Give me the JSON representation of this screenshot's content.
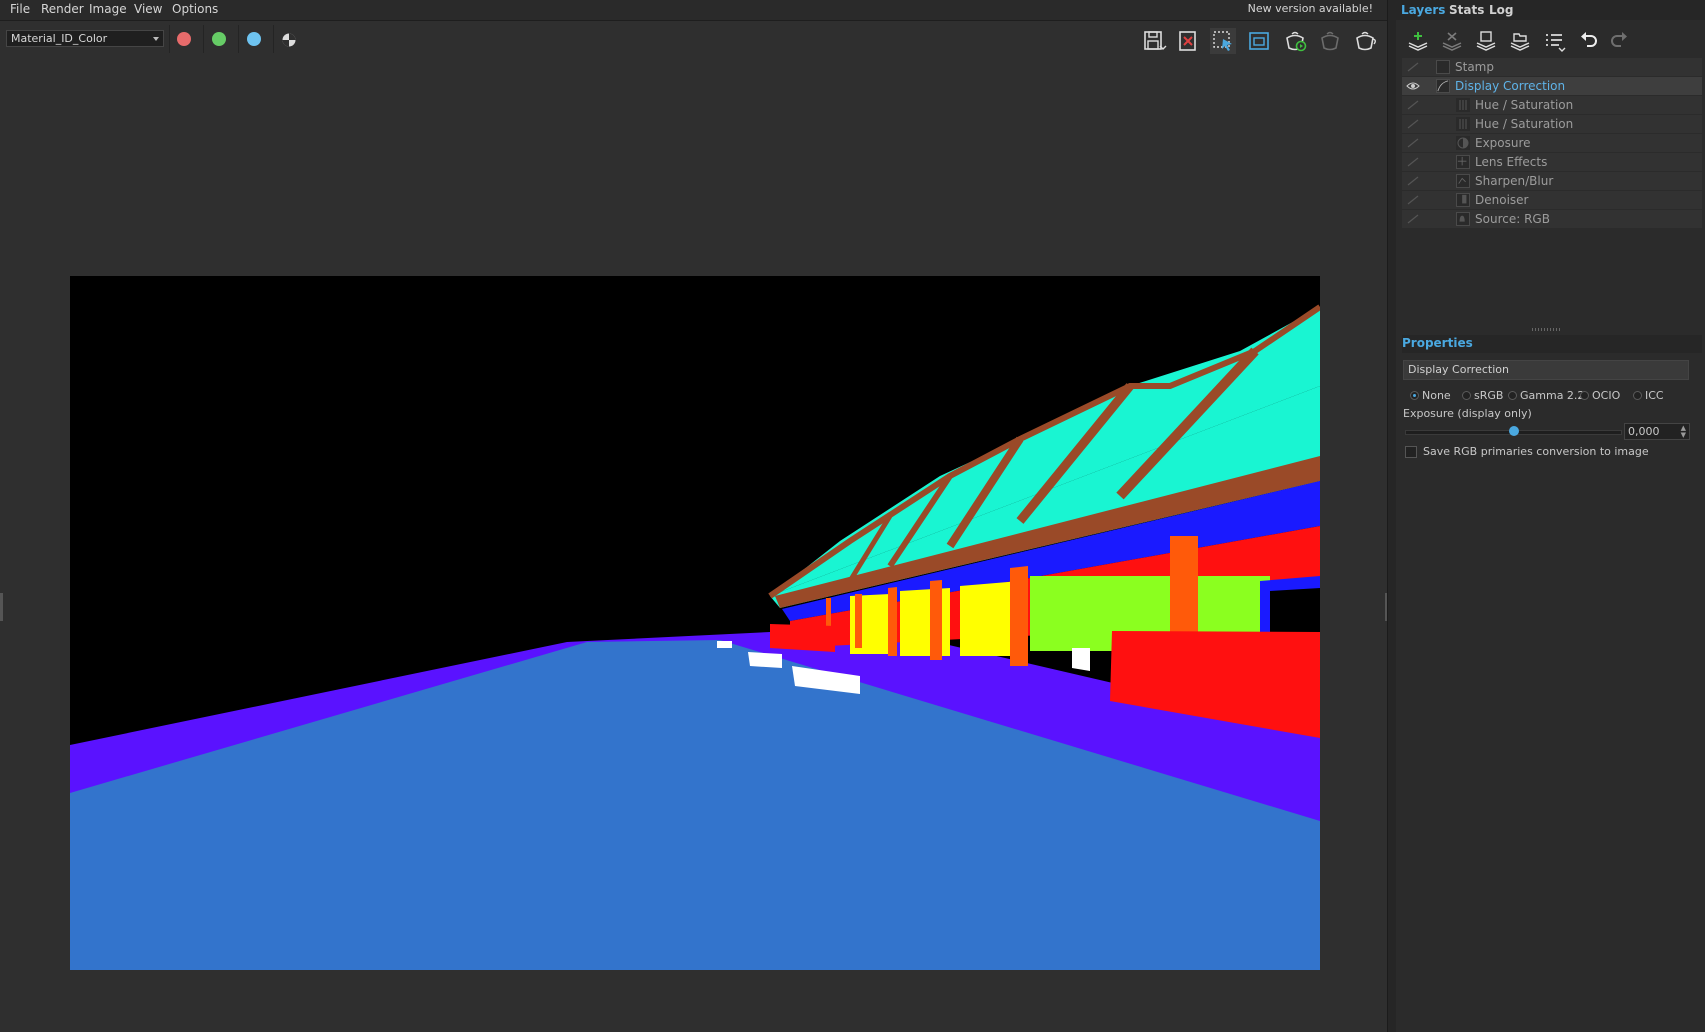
{
  "menu": [
    "File",
    "Render",
    "Image",
    "View",
    "Options"
  ],
  "notice": "New version available!",
  "toolbar": {
    "channel": "Material_ID_Color",
    "channel_dots": [
      {
        "name": "red-channel-toggle",
        "color": "#e76b6b"
      },
      {
        "name": "green-channel-toggle",
        "color": "#66cc66"
      },
      {
        "name": "blue-channel-toggle",
        "color": "#6ec3f0"
      }
    ],
    "icons": [
      "alpha-channel-icon",
      "save-image-icon",
      "clear-image-icon",
      "region-render-icon",
      "frame-buffer-icon",
      "render-icon",
      "stop-render-icon",
      "render-teapot-icon"
    ]
  },
  "tabs": [
    "Layers",
    "Stats",
    "Log"
  ],
  "layer_toolbar_icons": [
    "add-layer-icon",
    "delete-layer-icon",
    "save-layers-icon",
    "load-layers-icon",
    "layer-menu-icon",
    "undo-icon",
    "redo-icon"
  ],
  "layers": [
    {
      "name": "Stamp",
      "indent": 0,
      "selected": false,
      "visible": false
    },
    {
      "name": "Display Correction",
      "indent": 0,
      "selected": true,
      "visible": true
    },
    {
      "name": "Hue / Saturation",
      "indent": 1,
      "selected": false,
      "visible": false
    },
    {
      "name": "Hue / Saturation",
      "indent": 1,
      "selected": false,
      "visible": false
    },
    {
      "name": "Exposure",
      "indent": 1,
      "selected": false,
      "visible": false
    },
    {
      "name": "Lens Effects",
      "indent": 1,
      "selected": false,
      "visible": false
    },
    {
      "name": "Sharpen/Blur",
      "indent": 1,
      "selected": false,
      "visible": false
    },
    {
      "name": "Denoiser",
      "indent": 1,
      "selected": false,
      "visible": false
    },
    {
      "name": "Source: RGB",
      "indent": 1,
      "selected": false,
      "visible": false
    }
  ],
  "properties": {
    "title": "Properties",
    "layer_name": "Display Correction",
    "modes": [
      {
        "label": "None",
        "on": true
      },
      {
        "label": "sRGB",
        "on": false
      },
      {
        "label": "Gamma 2.2",
        "on": false
      },
      {
        "label": "OCIO",
        "on": false
      },
      {
        "label": "ICC",
        "on": false
      }
    ],
    "exposure_label": "Exposure (display only)",
    "exposure_value": "0,000",
    "exposure_level": 0.5,
    "save_label": "Save RGB primaries conversion to image",
    "save_checked": false
  },
  "colors": {
    "accent": "#4aa8e0",
    "sky": "#000000",
    "ground": "#3374cc",
    "curb": "#5a12ff",
    "roof": "#19f5d2",
    "beam": "#9a4a28",
    "wall": "#ff1010",
    "glass": "#8bff1f",
    "yellow": "#ffff00",
    "orange": "#ff5a0a",
    "blue": "#1a1aff",
    "white": "#ffffff"
  }
}
